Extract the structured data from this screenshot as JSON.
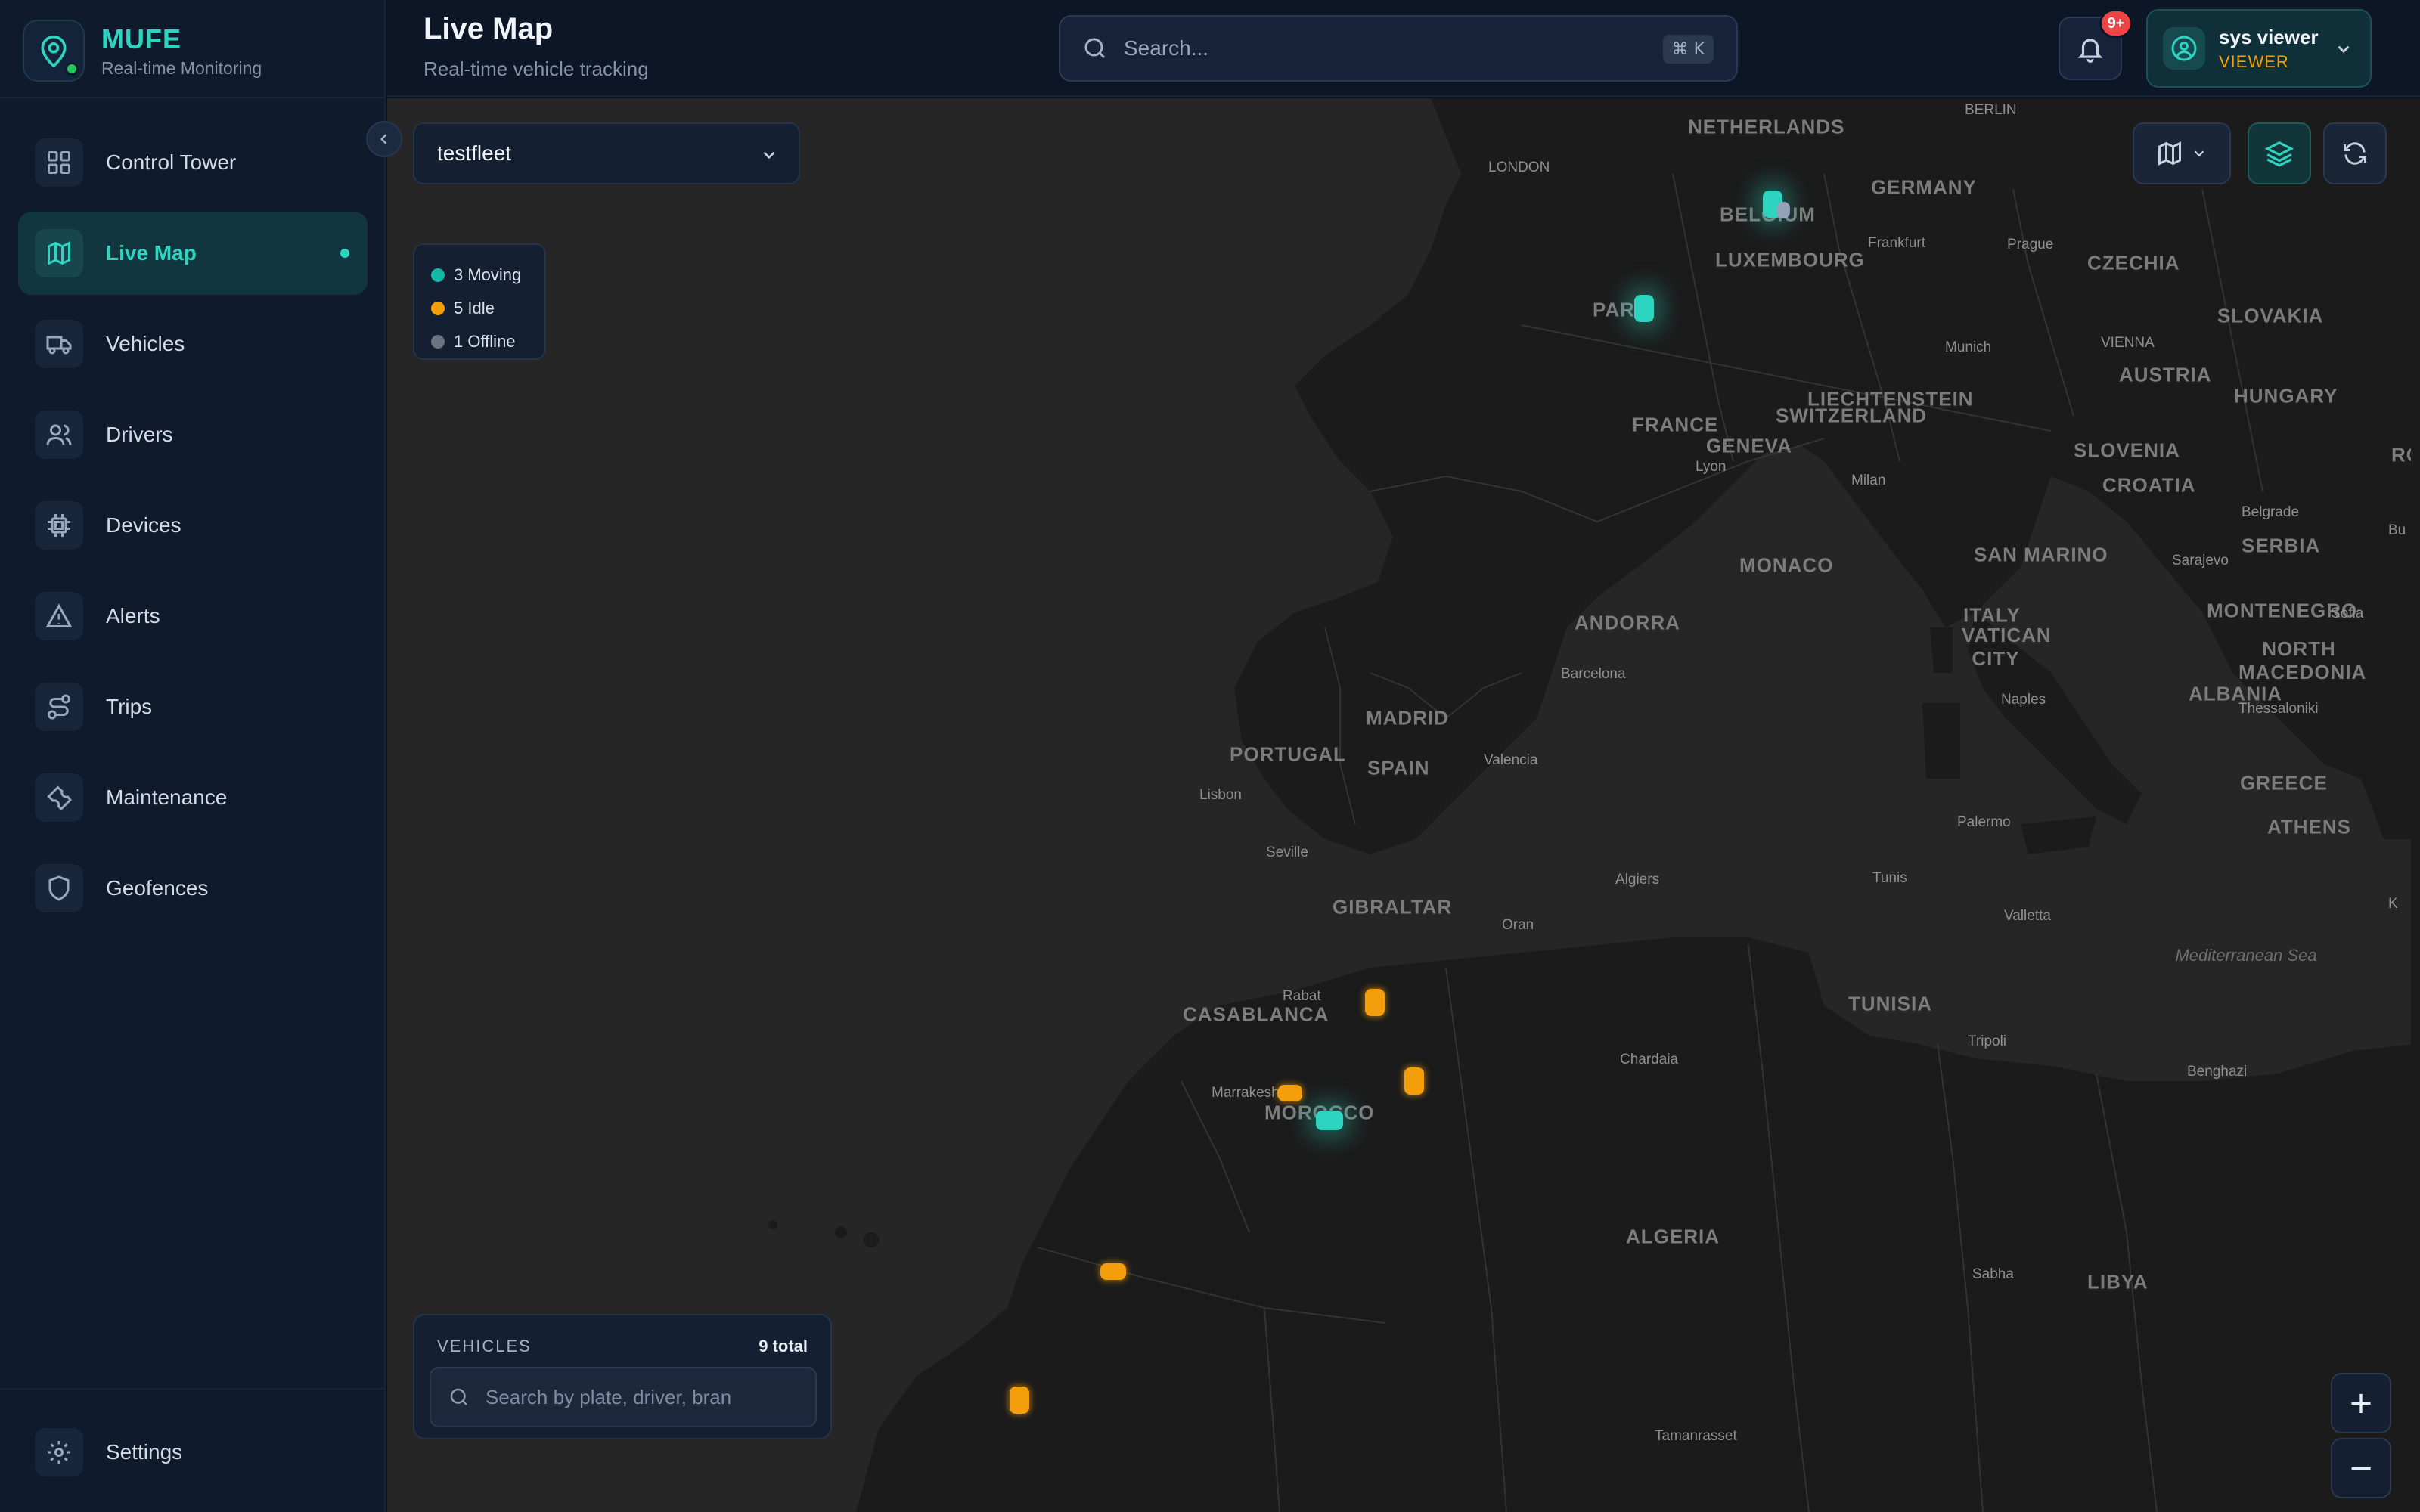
{
  "brand": {
    "name": "MUFE",
    "subtitle": "Real-time Monitoring"
  },
  "sidebar": {
    "items": [
      {
        "label": "Control Tower",
        "icon": "grid-icon"
      },
      {
        "label": "Live Map",
        "icon": "map-icon",
        "active": true
      },
      {
        "label": "Vehicles",
        "icon": "truck-icon"
      },
      {
        "label": "Drivers",
        "icon": "users-icon"
      },
      {
        "label": "Devices",
        "icon": "chip-icon"
      },
      {
        "label": "Alerts",
        "icon": "alert-triangle-icon"
      },
      {
        "label": "Trips",
        "icon": "route-icon"
      },
      {
        "label": "Maintenance",
        "icon": "wrench-icon"
      },
      {
        "label": "Geofences",
        "icon": "shield-icon"
      }
    ],
    "settings_label": "Settings"
  },
  "header": {
    "title": "Live Map",
    "subtitle": "Real-time vehicle tracking",
    "search_placeholder": "Search...",
    "search_shortcut": "⌘ K",
    "notifications_badge": "9+",
    "user_name": "sys viewer",
    "user_role": "VIEWER"
  },
  "map": {
    "fleet_selected": "testfleet",
    "legend": [
      {
        "label": "3 Moving",
        "color": "#14b8a6"
      },
      {
        "label": "5 Idle",
        "color": "#f59e0b"
      },
      {
        "label": "1 Offline",
        "color": "#6b7280"
      }
    ],
    "vehicles_panel": {
      "title": "VEHICLES",
      "count": "9 total",
      "search_placeholder": "Search by plate, driver, bran"
    },
    "zoom_in": "+",
    "zoom_out": "−",
    "labels": {
      "netherlands": "NETHERLANDS",
      "berlin": "BERLIN",
      "london": "LONDON",
      "belgium": "BELGIUM",
      "germany": "GERMANY",
      "frankfurt": "Frankfurt",
      "prague": "Prague",
      "luxembourg": "LUXEMBOURG",
      "czechia": "CZECHIA",
      "slovakia": "SLOVAKIA",
      "paris": "PARIS",
      "munich": "Munich",
      "vienna": "VIENNA",
      "austria": "AUSTRIA",
      "hungary": "HUNGARY",
      "liechtenstein": "LIECHTENSTEIN",
      "switzerland": "SWITZERLAND",
      "france": "FRANCE",
      "geneva": "GENEVA",
      "lyon": "Lyon",
      "slovenia": "SLOVENIA",
      "milan": "Milan",
      "croatia": "CROATIA",
      "romania": "ROM",
      "belgrade": "Belgrade",
      "serbia": "SERBIA",
      "san_marino": "SAN MARINO",
      "monaco": "MONACO",
      "sarajevo": "Sarajevo",
      "andorra": "ANDORRA",
      "italy": "ITALY",
      "montenegro": "MONTENEGRO",
      "sofia": "Sofia",
      "vatican": "VATICAN CITY",
      "barcelona": "Barcelona",
      "north_macedonia": "NORTH MACEDONIA",
      "albania": "ALBANIA",
      "napoli": "Naples",
      "thessaloniki": "Thessaloniki",
      "madrid": "MADRID",
      "portugal": "PORTUGAL",
      "spain": "SPAIN",
      "valencia": "Valencia",
      "lisboa": "Lisbon",
      "greece": "GREECE",
      "athens": "ATHENS",
      "palermo": "Palermo",
      "seville": "Seville",
      "gibraltar": "GIBRALTAR",
      "algiers": "Algiers",
      "tunis": "Tunis",
      "valletta": "Valletta",
      "oran": "Oran",
      "mediterranean": "Mediterranean Sea",
      "rabat": "Rabat",
      "casablanca": "CASABLANCA",
      "tunisia": "TUNISIA",
      "tripoli": "Tripoli",
      "chardaia": "Chardaia",
      "marrakesh": "Marrakesh",
      "morocco": "MOROCCO",
      "benghazi": "Benghazi",
      "algeria": "ALGERIA",
      "sabha": "Sabha",
      "libya": "LIBYA",
      "tamanrasset": "Tamanrasset",
      "bu": "Bu",
      "k": "K"
    }
  }
}
